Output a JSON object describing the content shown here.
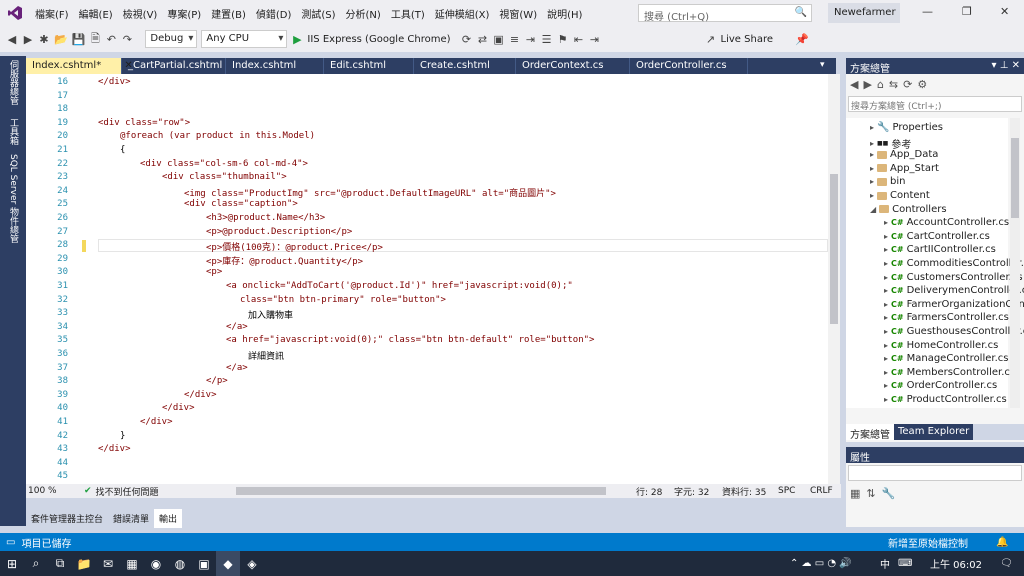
{
  "menu": [
    "檔案(F)",
    "編輯(E)",
    "檢視(V)",
    "專案(P)",
    "建置(B)",
    "偵錯(D)",
    "測試(S)",
    "分析(N)",
    "工具(T)",
    "延伸模組(X)",
    "視窗(W)",
    "說明(H)"
  ],
  "search": {
    "placeholder": "搜尋 (Ctrl+Q)"
  },
  "user": "Newefarmer",
  "toolbar": {
    "config": "Debug",
    "platform": "Any CPU",
    "run": "IIS Express (Google Chrome)",
    "live_share": "Live Share"
  },
  "leftbar": [
    "伺服器總管",
    "工具箱",
    "SQL Server 物件總管"
  ],
  "tabs": [
    "Index.cshtml*",
    "_CartPartial.cshtml",
    "Index.cshtml",
    "Edit.cshtml",
    "Create.cshtml",
    "OrderContext.cs",
    "OrderController.cs"
  ],
  "lines": [
    "16",
    "17",
    "18",
    "19",
    "20",
    "21",
    "22",
    "23",
    "24",
    "25",
    "26",
    "27",
    "28",
    "29",
    "30",
    "31",
    "32",
    "33",
    "34",
    "35",
    "36",
    "37",
    "38",
    "39",
    "40",
    "41",
    "42",
    "43",
    "44",
    "45"
  ],
  "code": {
    "l16": "</div>",
    "l19a": "<div",
    "l19b": " class=",
    "l19c": "\"row\"",
    "l20a": "@",
    "l20b": "foreach",
    " l20c": "",
    "l20rest": " (var product in this.Model)",
    "l21": "{",
    "l22": "<div class=\"col-sm-6 col-md-4\">",
    "l23": "<div class=\"thumbnail\">",
    "l24": "<img class=\"ProductImg\" src=\"@product.DefaultImageURL\" alt=\"商品圖片\">",
    "l25": "<div class=\"caption\">",
    "l26": "<h3>@product.Name</h3>",
    "l27": "<p>@product.Description</p>",
    "l28": "<p>價格(100克)：@product.Price</p>",
    "l29": "<p>庫存：@product.Quantity</p>",
    "l30": "<p>",
    "l31": "<a onclick=\"AddToCart('@product.Id')\" href=\"javascript:void(0);\"",
    "l32": "class=\"btn btn-primary\" role=\"button\">",
    "l33": "加入購物車",
    "l34": "</a>",
    "l35": "<a href=\"javascript:void(0);\" class=\"btn btn-default\" role=\"button\">",
    "l36": "詳細資訊",
    "l37": "</a>",
    "l38": "</p>",
    "l39": "</div>",
    "l40": "</div>",
    "l41": "</div>",
    "l42": "}",
    "l43": "</div>"
  },
  "status": {
    "zoom": "100 %",
    "issues": "找不到任何問題",
    "line": "行: 28",
    "char": "字元: 32",
    "col": "資料行: 35",
    "spc": "SPC",
    "crlf": "CRLF"
  },
  "output_tabs": [
    "套件管理器主控台",
    "錯誤清單",
    "輸出"
  ],
  "solution": {
    "title": "方案總管",
    "search": "搜尋方案總管 (Ctrl+;)",
    "items": [
      "Properties",
      "參考",
      "App_Data",
      "App_Start",
      "bin",
      "Content",
      "Controllers",
      "AccountController.cs",
      "CartController.cs",
      "CartIIController.cs",
      "CommoditiesController.cs",
      "CustomersController.cs",
      "DeliverymenController.cs",
      "FarmerOrganizationController.cs",
      "FarmersController.cs",
      "GuesthousesController.cs",
      "HomeController.cs",
      "ManageController.cs",
      "MembersController.cs",
      "OrderController.cs",
      "ProductController.cs"
    ],
    "tabs": [
      "方案總管",
      "Team Explorer"
    ]
  },
  "properties": {
    "title": "屬性"
  },
  "statusbar": {
    "left": "項目已儲存",
    "right": "新增至原始檔控制"
  },
  "taskbar": {
    "lang": "中",
    "time": "上午 06:02"
  }
}
